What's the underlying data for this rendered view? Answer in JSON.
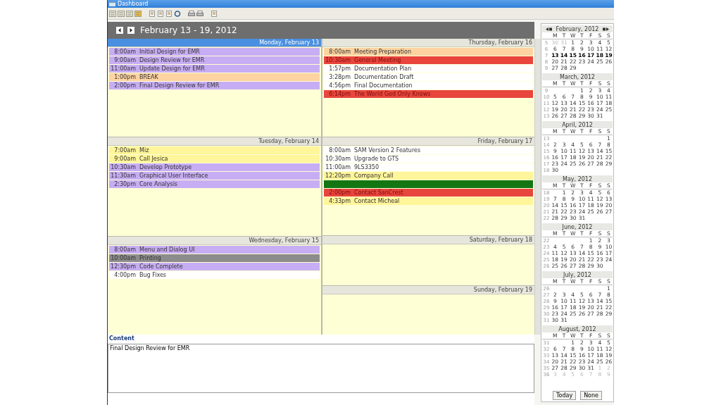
{
  "window": {
    "title": "Dashboard"
  },
  "header": {
    "title": "February 13 - 19, 2012"
  },
  "days": [
    {
      "label": "Monday, February 13",
      "selected": true,
      "kind": "weekday",
      "events": [
        {
          "time": "8:00am",
          "title": "Initial Design for EMR",
          "color": "#c7adf3"
        },
        {
          "time": "9:00am",
          "title": "Design Review for EMR",
          "color": "#c7adf3"
        },
        {
          "time": "11:00am",
          "title": "Update Design for EMR",
          "color": "#c7adf3"
        },
        {
          "time": "1:00pm",
          "title": "BREAK",
          "color": "#fcd3a1"
        },
        {
          "time": "2:00pm",
          "title": "Final Design Review for EMR",
          "color": "#c7adf3"
        }
      ]
    },
    {
      "label": "Tuesday, February 14",
      "selected": false,
      "kind": "weekday",
      "events": [
        {
          "time": "7:00am",
          "title": "Miz",
          "color": "#fff59a"
        },
        {
          "time": "9:00am",
          "title": "Call Jesica",
          "color": "#fff59a"
        },
        {
          "time": "10:30am",
          "title": "Develop Prototype",
          "color": "#c7adf3"
        },
        {
          "time": "11:30am",
          "title": "Graphical User Interface",
          "color": "#c7adf3"
        },
        {
          "time": "2:30pm",
          "title": "Core Analysis",
          "color": "#c7adf3"
        }
      ]
    },
    {
      "label": "Wednesday, February 15",
      "selected": false,
      "kind": "weekday",
      "events": [
        {
          "time": "8:00am",
          "title": "Menu and Dialog UI",
          "color": "#c7adf3"
        },
        {
          "time": "10:00am",
          "title": "Printing",
          "color": "#8c8c8c"
        },
        {
          "time": "12:30pm",
          "title": "Code Complete",
          "color": "#c7adf3"
        },
        {
          "time": "4:00pm",
          "title": "Bug Fixes",
          "color": "#ffffff"
        }
      ]
    },
    {
      "label": "Thursday, February 16",
      "selected": false,
      "kind": "weekday",
      "events": [
        {
          "time": "8:00am",
          "title": "Meeting Preparation",
          "color": "#fcd3a1"
        },
        {
          "time": "10:30am",
          "title": "General Meeting",
          "color": "#e8453c"
        },
        {
          "time": "1:57pm",
          "title": "Documentation Plan",
          "color": "#ffffff"
        },
        {
          "time": "3:28pm",
          "title": "Documentation Draft",
          "color": "#ffffff"
        },
        {
          "time": "4:56pm",
          "title": "Final Documentation",
          "color": "#ffffff"
        },
        {
          "time": "6:14pm",
          "title": "The World God Only Knows",
          "color": "#e8453c"
        }
      ]
    },
    {
      "label": "Friday, February 17",
      "selected": false,
      "kind": "weekday",
      "events": [
        {
          "time": "8:00am",
          "title": "SAM Version 2 Features",
          "color": "#ffffff"
        },
        {
          "time": "10:30am",
          "title": "Upgrade to GTS",
          "color": "#ffffff"
        },
        {
          "time": "11:00am",
          "title": "9LS3350",
          "color": "#ffffff"
        },
        {
          "time": "12:20pm",
          "title": "Company Call",
          "color": "#fff59a"
        },
        {
          "color": "#137613"
        },
        {
          "time": "2:00pm",
          "title": "Contact SanCrest",
          "color": "#e8453c"
        },
        {
          "time": "4:33pm",
          "title": "Contact Micheal",
          "color": "#fff59a"
        }
      ]
    },
    {
      "label": "Saturday, February 18",
      "selected": false,
      "kind": "weekend"
    },
    {
      "label": "Sunday, February 19",
      "selected": false,
      "kind": "weekend"
    }
  ],
  "content": {
    "label": "Content",
    "value": "Final Design Review for EMR"
  },
  "calendar": {
    "months": [
      {
        "title": "February, 2012",
        "weekdays": [
          "M",
          "T",
          "W",
          "T",
          "F",
          "S",
          "S"
        ],
        "weeks": [
          {
            "week": "5",
            "before": [
              "30",
              "31"
            ],
            "days": [
              "1",
              "2",
              "3",
              "4",
              "5"
            ]
          },
          {
            "week": "6",
            "days": [
              "6",
              "7",
              "8",
              "9",
              "10",
              "11",
              "12"
            ]
          },
          {
            "week": "7",
            "selected": true,
            "days": [
              "13",
              "14",
              "15",
              "16",
              "17",
              "18",
              "19"
            ]
          },
          {
            "week": "8",
            "days": [
              "20",
              "21",
              "22",
              "23",
              "24",
              "25",
              "26"
            ]
          },
          {
            "week": "9",
            "days": [
              "27",
              "28",
              "29"
            ]
          }
        ]
      },
      {
        "title": "March, 2012",
        "weekdays": [
          "M",
          "T",
          "W",
          "T",
          "F",
          "S",
          "S"
        ],
        "weeks": [
          {
            "week": "9",
            "days": [
              "1",
              "2",
              "3",
              "4"
            ]
          },
          {
            "week": "10",
            "days": [
              "5",
              "6",
              "7",
              "8",
              "9",
              "10",
              "11"
            ]
          },
          {
            "week": "11",
            "days": [
              "12",
              "13",
              "14",
              "15",
              "16",
              "17",
              "18"
            ]
          },
          {
            "week": "12",
            "days": [
              "19",
              "20",
              "21",
              "22",
              "23",
              "24",
              "25"
            ]
          },
          {
            "week": "13",
            "days": [
              "26",
              "27",
              "28",
              "29",
              "30",
              "31"
            ]
          }
        ]
      },
      {
        "title": "April, 2012",
        "weekdays": [
          "M",
          "T",
          "W",
          "T",
          "F",
          "S",
          "S"
        ],
        "weeks": [
          {
            "week": "13",
            "days": [
              "1"
            ]
          },
          {
            "week": "14",
            "days": [
              "2",
              "3",
              "4",
              "5",
              "6",
              "7",
              "8"
            ]
          },
          {
            "week": "15",
            "days": [
              "9",
              "10",
              "11",
              "12",
              "13",
              "14",
              "15"
            ]
          },
          {
            "week": "16",
            "days": [
              "16",
              "17",
              "18",
              "19",
              "20",
              "21",
              "22"
            ]
          },
          {
            "week": "17",
            "days": [
              "23",
              "24",
              "25",
              "26",
              "27",
              "28",
              "29"
            ]
          },
          {
            "week": "18",
            "days": [
              "30"
            ]
          }
        ]
      },
      {
        "title": "May, 2012",
        "weekdays": [
          "M",
          "T",
          "W",
          "T",
          "F",
          "S",
          "S"
        ],
        "weeks": [
          {
            "week": "18",
            "days": [
              "1",
              "2",
              "3",
              "4",
              "5",
              "6"
            ]
          },
          {
            "week": "19",
            "days": [
              "7",
              "8",
              "9",
              "10",
              "11",
              "12",
              "13"
            ]
          },
          {
            "week": "20",
            "days": [
              "14",
              "15",
              "16",
              "17",
              "18",
              "19",
              "20"
            ]
          },
          {
            "week": "21",
            "days": [
              "21",
              "22",
              "23",
              "24",
              "25",
              "26",
              "27"
            ]
          },
          {
            "week": "22",
            "days": [
              "28",
              "29",
              "30",
              "31"
            ]
          }
        ]
      },
      {
        "title": "June, 2012",
        "weekdays": [
          "M",
          "T",
          "W",
          "T",
          "F",
          "S",
          "S"
        ],
        "weeks": [
          {
            "week": "22",
            "days": [
              "1",
              "2",
              "3"
            ]
          },
          {
            "week": "23",
            "days": [
              "4",
              "5",
              "6",
              "7",
              "8",
              "9",
              "10"
            ]
          },
          {
            "week": "24",
            "days": [
              "11",
              "12",
              "13",
              "14",
              "15",
              "16",
              "17"
            ]
          },
          {
            "week": "25",
            "days": [
              "18",
              "19",
              "20",
              "21",
              "22",
              "23",
              "24"
            ]
          },
          {
            "week": "26",
            "days": [
              "25",
              "26",
              "27",
              "28",
              "29",
              "30"
            ]
          }
        ]
      },
      {
        "title": "July, 2012",
        "weekdays": [
          "M",
          "T",
          "W",
          "T",
          "F",
          "S",
          "S"
        ],
        "weeks": [
          {
            "week": "26",
            "days": [
              "1"
            ]
          },
          {
            "week": "27",
            "days": [
              "2",
              "3",
              "4",
              "5",
              "6",
              "7",
              "8"
            ]
          },
          {
            "week": "28",
            "days": [
              "9",
              "10",
              "11",
              "12",
              "13",
              "14",
              "15"
            ]
          },
          {
            "week": "29",
            "days": [
              "16",
              "17",
              "18",
              "19",
              "20",
              "21",
              "22"
            ]
          },
          {
            "week": "30",
            "days": [
              "23",
              "24",
              "25",
              "26",
              "27",
              "28",
              "29"
            ]
          },
          {
            "week": "31",
            "days": [
              "30",
              "31"
            ]
          }
        ]
      },
      {
        "title": "August, 2012",
        "weekdays": [
          "M",
          "T",
          "W",
          "T",
          "F",
          "S",
          "S"
        ],
        "weeks": [
          {
            "week": "31",
            "days": [
              "1",
              "2",
              "3",
              "4",
              "5"
            ]
          },
          {
            "week": "32",
            "days": [
              "6",
              "7",
              "8",
              "9",
              "10",
              "11",
              "12"
            ]
          },
          {
            "week": "33",
            "days": [
              "13",
              "14",
              "15",
              "16",
              "17",
              "18",
              "19"
            ]
          },
          {
            "week": "34",
            "days": [
              "20",
              "21",
              "22",
              "23",
              "24",
              "25",
              "26"
            ]
          },
          {
            "week": "35",
            "days": [
              "27",
              "28",
              "29",
              "30",
              "31"
            ],
            "after": [
              "1",
              "2"
            ]
          },
          {
            "week": "36",
            "after": [
              "3",
              "4",
              "5",
              "6",
              "7",
              "8",
              "9"
            ]
          }
        ]
      }
    ]
  },
  "buttons": [
    "Today",
    "None"
  ]
}
